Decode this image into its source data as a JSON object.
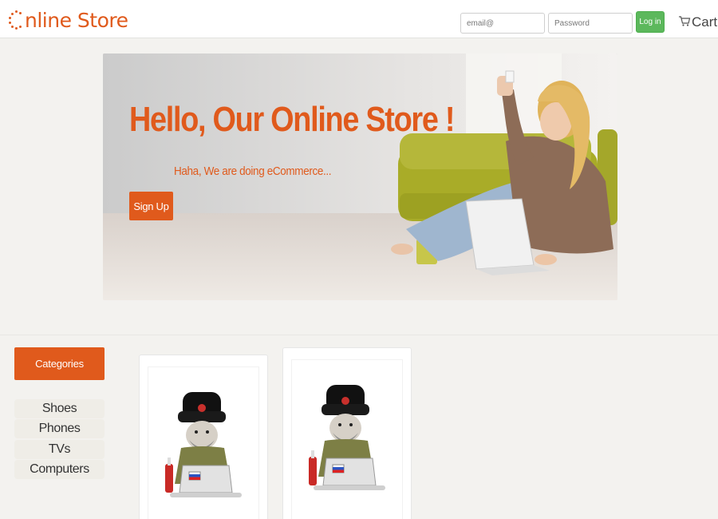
{
  "header": {
    "logo_text": "nline Store",
    "email_placeholder": "email@",
    "password_placeholder": "Password",
    "login_label": "Log in",
    "cart_label": "Cart"
  },
  "hero": {
    "title": "Hello, Our Online Store !",
    "subtitle": "Haha, We are doing eCommerce...",
    "signup_label": "Sign Up"
  },
  "sidebar": {
    "header": "Categories",
    "items": [
      {
        "label": "Shoes"
      },
      {
        "label": "Phones"
      },
      {
        "label": "TVs"
      },
      {
        "label": "Computers"
      }
    ]
  },
  "products": [
    {
      "image": "soldier-with-laptop-illustration"
    },
    {
      "image": "soldier-with-laptop-illustration"
    }
  ],
  "colors": {
    "accent": "#e05a1c",
    "login_button": "#5cb85c",
    "background": "#f3f2ef"
  },
  "icons": {
    "logo": "dotted-circle-logo-icon",
    "cart": "cart-icon"
  }
}
